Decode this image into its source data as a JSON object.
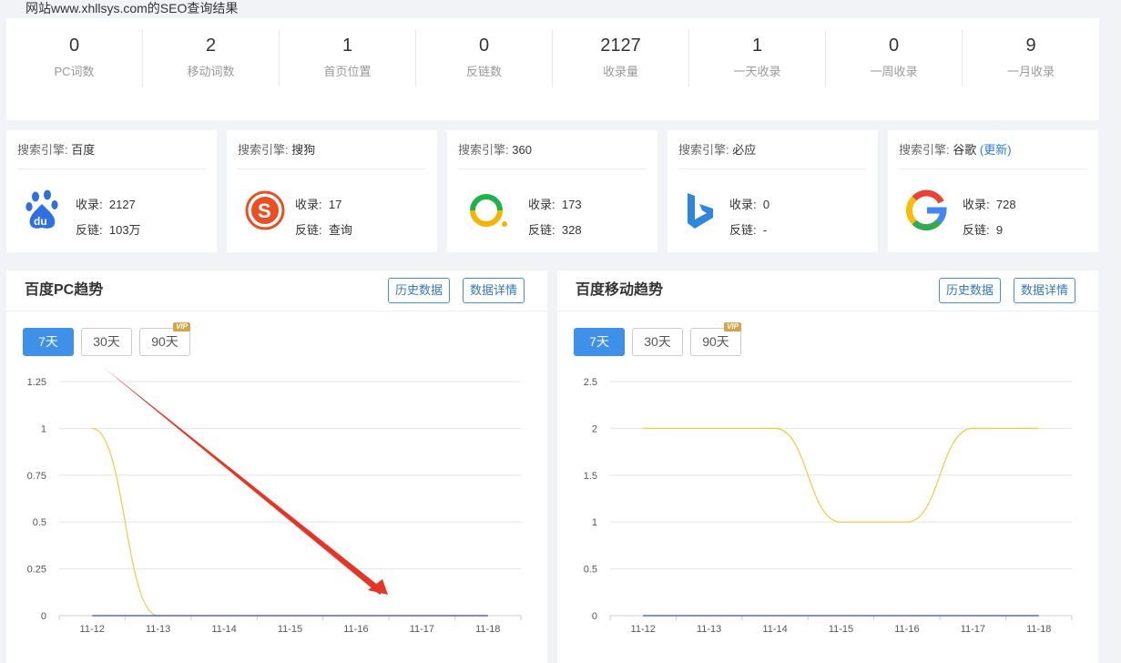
{
  "page_title": "网站www.xhllsys.com的SEO查询结果",
  "stats": [
    {
      "value": "0",
      "label": "PC词数"
    },
    {
      "value": "2",
      "label": "移动词数"
    },
    {
      "value": "1",
      "label": "首页位置"
    },
    {
      "value": "0",
      "label": "反链数"
    },
    {
      "value": "2127",
      "label": "收录量"
    },
    {
      "value": "1",
      "label": "一天收录"
    },
    {
      "value": "0",
      "label": "一周收录"
    },
    {
      "value": "9",
      "label": "一月收录"
    }
  ],
  "engines": [
    {
      "prefix": "搜索引擎: ",
      "name": "百度",
      "link": "",
      "logo": "baidu-logo",
      "index_label": "收录:",
      "index_value": "2127",
      "backlink_label": "反链:",
      "backlink_value": "103万"
    },
    {
      "prefix": "搜索引擎: ",
      "name": "搜狗",
      "link": "",
      "logo": "sogou-logo",
      "index_label": "收录:",
      "index_value": "17",
      "backlink_label": "反链:",
      "backlink_value": "查询"
    },
    {
      "prefix": "搜索引擎: ",
      "name": "360",
      "link": "",
      "logo": "so360-logo",
      "index_label": "收录:",
      "index_value": "173",
      "backlink_label": "反链:",
      "backlink_value": "328"
    },
    {
      "prefix": "搜索引擎: ",
      "name": "必应",
      "link": "",
      "logo": "bing-logo",
      "index_label": "收录:",
      "index_value": "0",
      "backlink_label": "反链:",
      "backlink_value": "-"
    },
    {
      "prefix": "搜索引擎: ",
      "name": "谷歌",
      "link": "(更新)",
      "logo": "google-logo",
      "index_label": "收录:",
      "index_value": "728",
      "backlink_label": "反链:",
      "backlink_value": "9"
    }
  ],
  "panels": [
    {
      "title": "百度PC趋势",
      "history_button": "历史数据",
      "detail_button": "数据详情",
      "ranges": [
        "7天",
        "30天",
        "90天"
      ],
      "vip": "VIP"
    },
    {
      "title": "百度移动趋势",
      "history_button": "历史数据",
      "detail_button": "数据详情",
      "ranges": [
        "7天",
        "30天",
        "90天"
      ],
      "vip": "VIP"
    }
  ],
  "colors": {
    "accent": "#3e90e8",
    "line_yellow": "#f5c842",
    "line_blue": "#3b49c2",
    "arrow": "#e53527"
  },
  "chart_data": [
    {
      "type": "line",
      "categories": [
        "11-12",
        "11-13",
        "11-14",
        "11-15",
        "11-16",
        "11-17",
        "11-18"
      ],
      "yticks": [
        "0",
        "0.25",
        "0.5",
        "0.75",
        "1",
        "1.25"
      ],
      "ylim": [
        0,
        1.25
      ],
      "series": [
        {
          "values": [
            1,
            0,
            0,
            0,
            0,
            0,
            0
          ],
          "color": "#f5c842"
        },
        {
          "values": [
            0,
            0,
            0,
            0,
            0,
            0,
            0
          ],
          "color": "#3b49c2"
        }
      ],
      "grid": true
    },
    {
      "type": "line",
      "categories": [
        "11-12",
        "11-13",
        "11-14",
        "11-15",
        "11-16",
        "11-17",
        "11-18"
      ],
      "yticks": [
        "0",
        "0.5",
        "1",
        "1.5",
        "2",
        "2.5"
      ],
      "ylim": [
        0,
        2.5
      ],
      "series": [
        {
          "values": [
            2,
            2,
            2,
            1,
            1,
            2,
            2
          ],
          "color": "#f5c842"
        },
        {
          "values": [
            0,
            0,
            0,
            0,
            0,
            0,
            0
          ],
          "color": "#3b49c2"
        }
      ],
      "grid": true
    }
  ]
}
